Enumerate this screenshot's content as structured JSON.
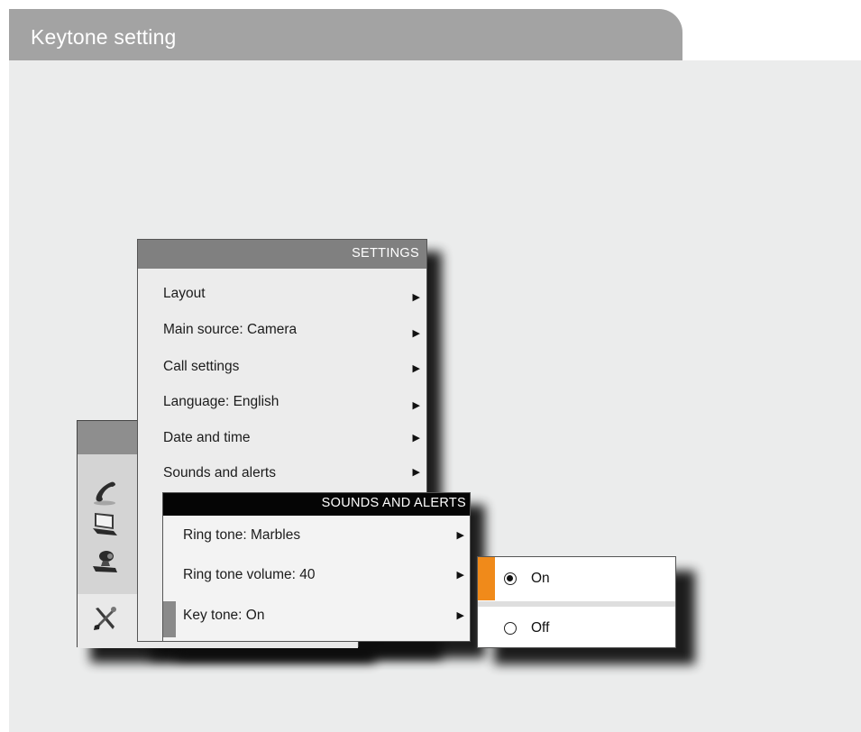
{
  "window": {
    "title": "Keytone setting"
  },
  "main_menu": {
    "icons": [
      "phone-icon",
      "laptop-icon",
      "camera-icon",
      "tools-icon"
    ]
  },
  "settings": {
    "header": "SETTINGS",
    "items": [
      {
        "label": "Layout"
      },
      {
        "label": "Main source: Camera"
      },
      {
        "label": "Call settings"
      },
      {
        "label": "Language: English"
      },
      {
        "label": "Date and time"
      },
      {
        "label": "Sounds and alerts"
      }
    ]
  },
  "sounds_and_alerts": {
    "header": "SOUNDS AND ALERTS",
    "items": [
      {
        "label": "Ring tone: Marbles"
      },
      {
        "label": "Ring tone volume: 40"
      },
      {
        "label": "Key tone: On"
      }
    ]
  },
  "key_tone_options": {
    "options": [
      {
        "label": "On",
        "selected": true
      },
      {
        "label": "Off",
        "selected": false
      }
    ],
    "accent_color": "#f08a1a"
  }
}
